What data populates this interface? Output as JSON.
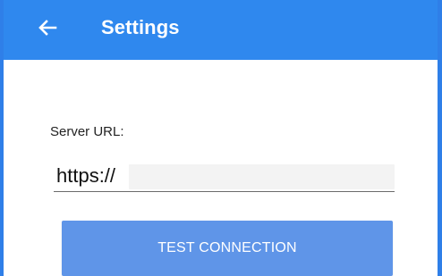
{
  "header": {
    "title": "Settings",
    "back_icon": "arrow-left-icon"
  },
  "settings": {
    "server_url_label": "Server URL:",
    "server_url_value": "https://",
    "test_connection_label": "TEST CONNECTION"
  },
  "colors": {
    "app_bar": "#2f88ee",
    "button": "#5f95e8",
    "border": "#2f7fe8",
    "input_underline": "#6b6b6b"
  }
}
